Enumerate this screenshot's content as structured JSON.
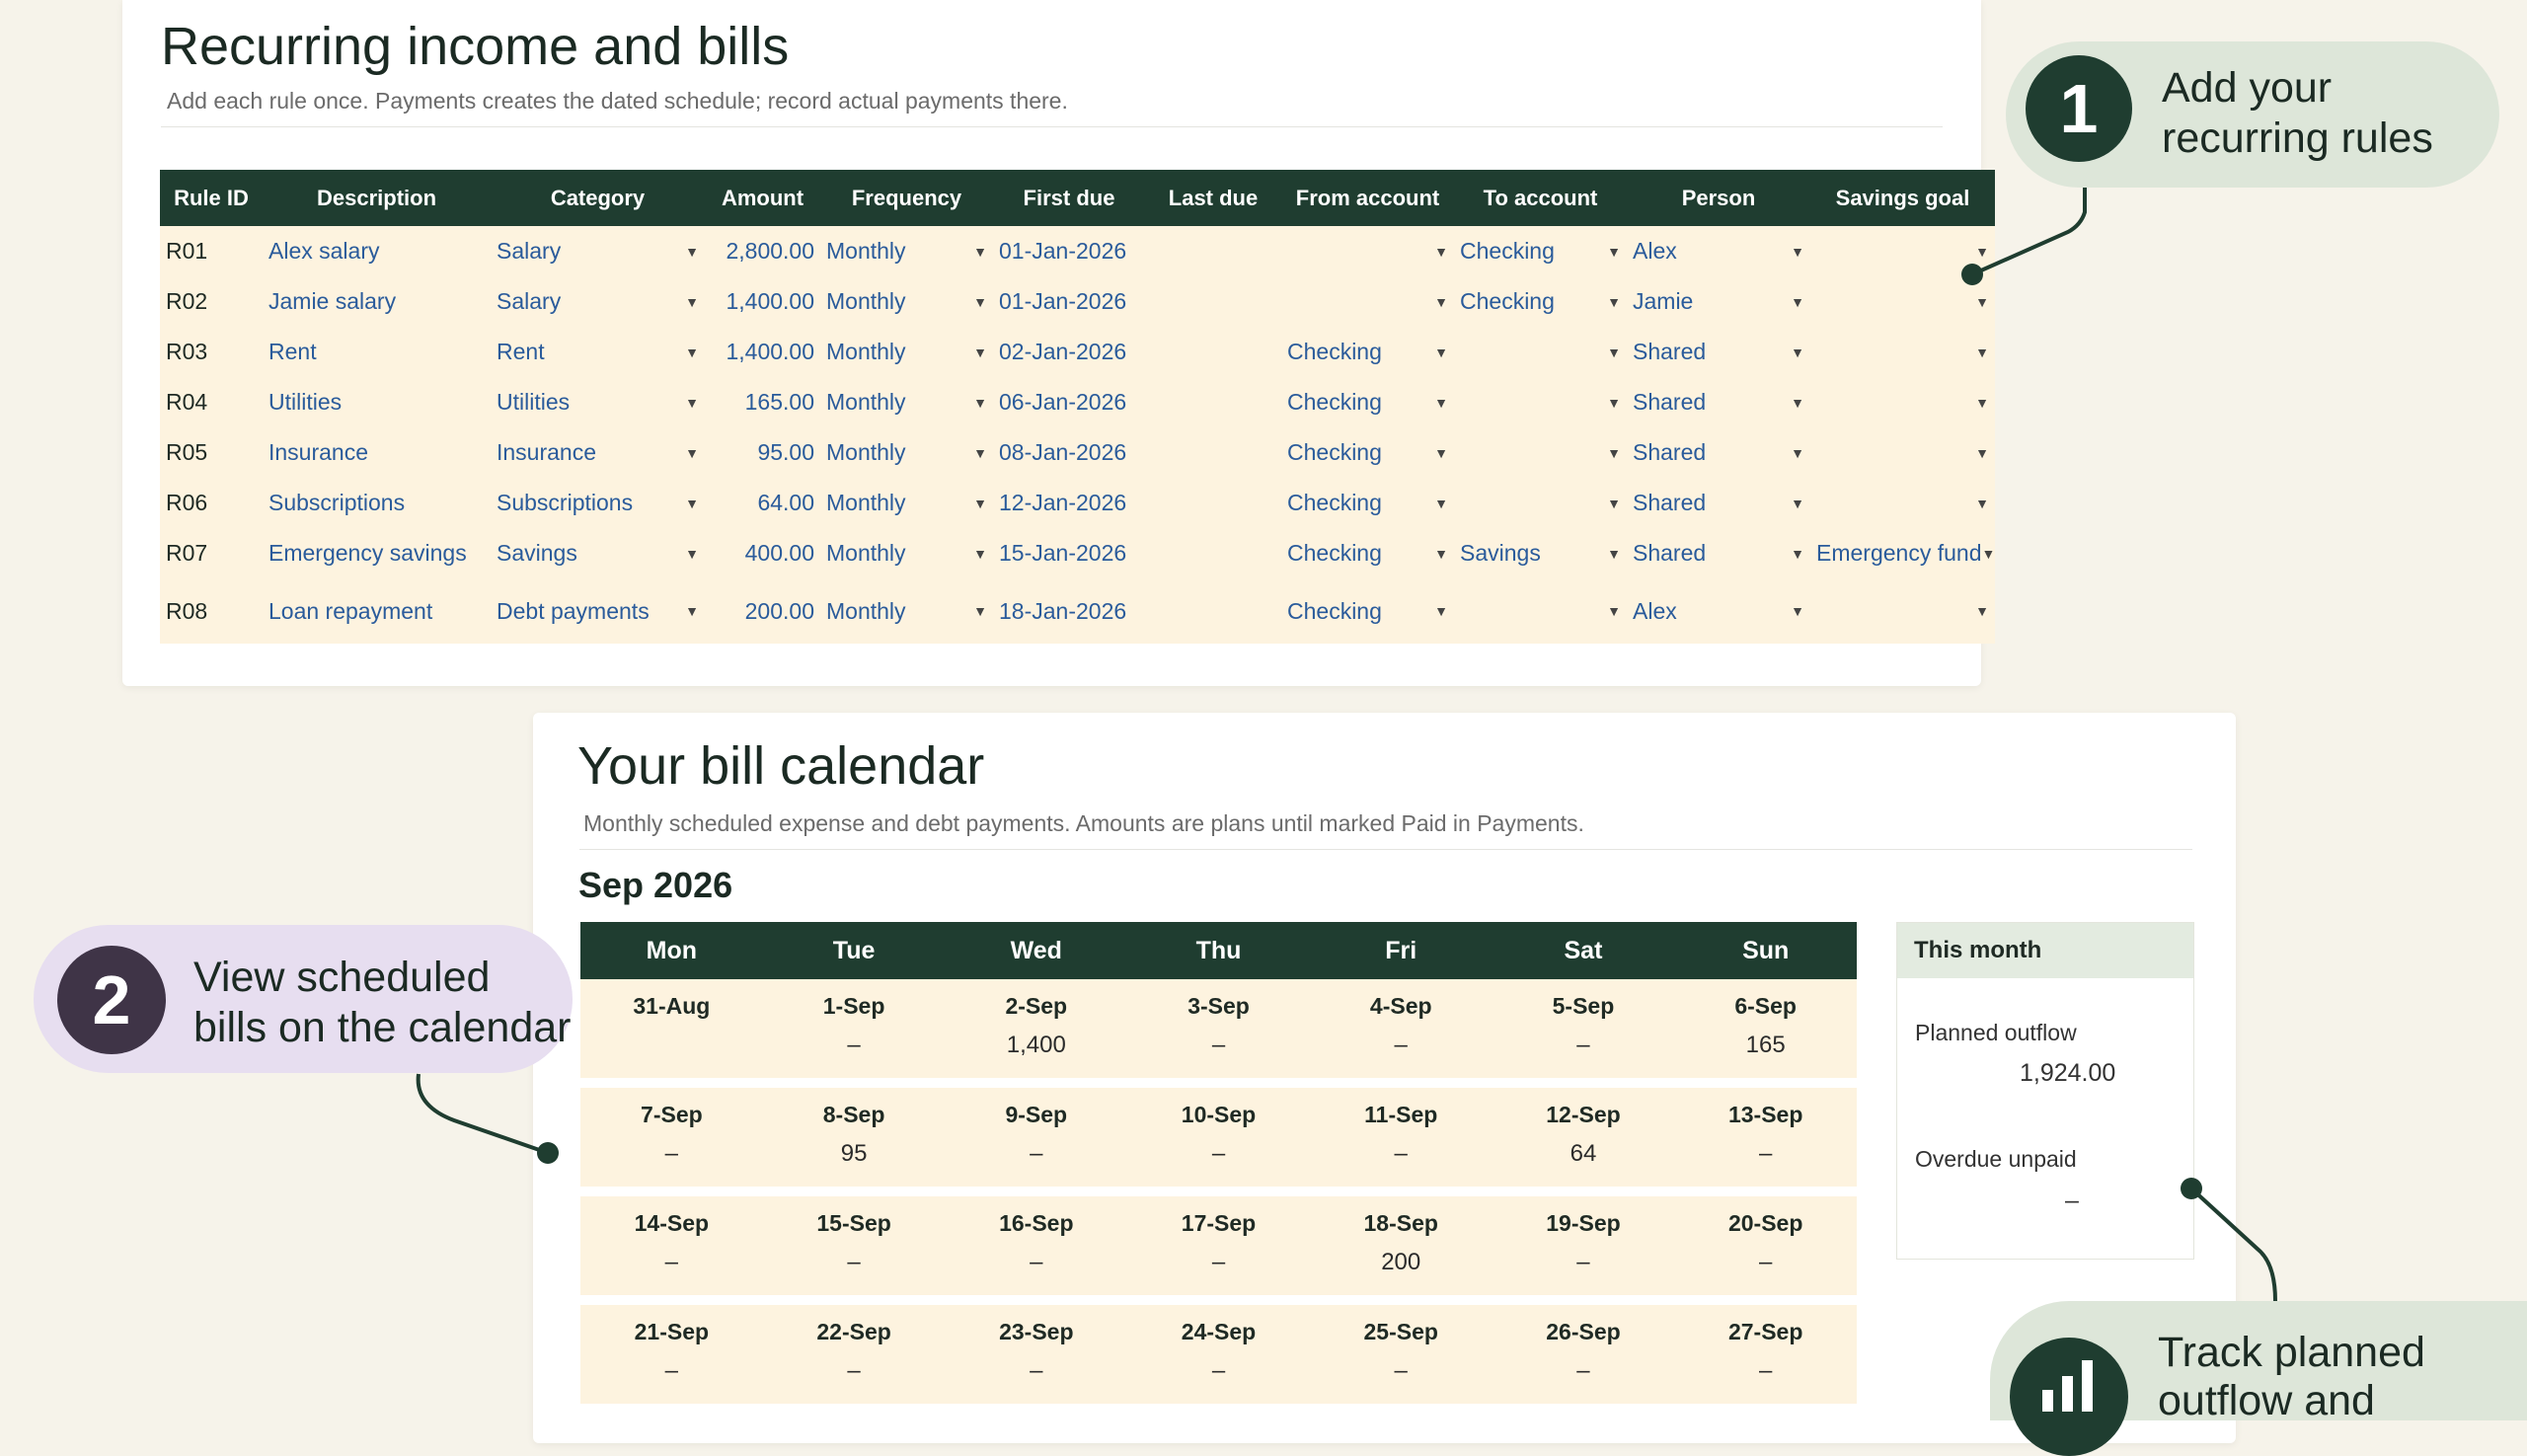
{
  "rules_panel": {
    "title": "Recurring income and bills",
    "subtitle": "Add each rule once. Payments creates the dated schedule; record actual payments there.",
    "columns": [
      "Rule ID",
      "Description",
      "Category",
      "Amount",
      "Frequency",
      "First due",
      "Last due",
      "From account",
      "To account",
      "Person",
      "Savings goal"
    ],
    "rows": [
      {
        "id": "R01",
        "description": "Alex salary",
        "category": "Salary",
        "amount": "2,800.00",
        "frequency": "Monthly",
        "first_due": "01-Jan-2026",
        "last_due": "",
        "from_account": "",
        "to_account": "Checking",
        "person": "Alex",
        "savings_goal": ""
      },
      {
        "id": "R02",
        "description": "Jamie salary",
        "category": "Salary",
        "amount": "1,400.00",
        "frequency": "Monthly",
        "first_due": "01-Jan-2026",
        "last_due": "",
        "from_account": "",
        "to_account": "Checking",
        "person": "Jamie",
        "savings_goal": ""
      },
      {
        "id": "R03",
        "description": "Rent",
        "category": "Rent",
        "amount": "1,400.00",
        "frequency": "Monthly",
        "first_due": "02-Jan-2026",
        "last_due": "",
        "from_account": "Checking",
        "to_account": "",
        "person": "Shared",
        "savings_goal": ""
      },
      {
        "id": "R04",
        "description": "Utilities",
        "category": "Utilities",
        "amount": "165.00",
        "frequency": "Monthly",
        "first_due": "06-Jan-2026",
        "last_due": "",
        "from_account": "Checking",
        "to_account": "",
        "person": "Shared",
        "savings_goal": ""
      },
      {
        "id": "R05",
        "description": "Insurance",
        "category": "Insurance",
        "amount": "95.00",
        "frequency": "Monthly",
        "first_due": "08-Jan-2026",
        "last_due": "",
        "from_account": "Checking",
        "to_account": "",
        "person": "Shared",
        "savings_goal": ""
      },
      {
        "id": "R06",
        "description": "Subscriptions",
        "category": "Subscriptions",
        "amount": "64.00",
        "frequency": "Monthly",
        "first_due": "12-Jan-2026",
        "last_due": "",
        "from_account": "Checking",
        "to_account": "",
        "person": "Shared",
        "savings_goal": ""
      },
      {
        "id": "R07",
        "description": "Emergency savings",
        "category": "Savings",
        "amount": "400.00",
        "frequency": "Monthly",
        "first_due": "15-Jan-2026",
        "last_due": "",
        "from_account": "Checking",
        "to_account": "Savings",
        "person": "Shared",
        "savings_goal": "Emergency fund"
      },
      {
        "id": "R08",
        "description": "Loan repayment",
        "category": "Debt payments",
        "amount": "200.00",
        "frequency": "Monthly",
        "first_due": "18-Jan-2026",
        "last_due": "",
        "from_account": "Checking",
        "to_account": "",
        "person": "Alex",
        "savings_goal": ""
      }
    ]
  },
  "calendar_panel": {
    "title": "Your bill calendar",
    "subtitle": "Monthly scheduled expense and debt payments. Amounts are plans until marked Paid in Payments.",
    "month": "Sep 2026",
    "weekdays": [
      "Mon",
      "Tue",
      "Wed",
      "Thu",
      "Fri",
      "Sat",
      "Sun"
    ],
    "weeks": [
      [
        {
          "date": "31-Aug",
          "value": ""
        },
        {
          "date": "1-Sep",
          "value": "–"
        },
        {
          "date": "2-Sep",
          "value": "1,400"
        },
        {
          "date": "3-Sep",
          "value": "–"
        },
        {
          "date": "4-Sep",
          "value": "–"
        },
        {
          "date": "5-Sep",
          "value": "–"
        },
        {
          "date": "6-Sep",
          "value": "165"
        }
      ],
      [
        {
          "date": "7-Sep",
          "value": "–"
        },
        {
          "date": "8-Sep",
          "value": "95"
        },
        {
          "date": "9-Sep",
          "value": "–"
        },
        {
          "date": "10-Sep",
          "value": "–"
        },
        {
          "date": "11-Sep",
          "value": "–"
        },
        {
          "date": "12-Sep",
          "value": "64"
        },
        {
          "date": "13-Sep",
          "value": "–"
        }
      ],
      [
        {
          "date": "14-Sep",
          "value": "–"
        },
        {
          "date": "15-Sep",
          "value": "–"
        },
        {
          "date": "16-Sep",
          "value": "–"
        },
        {
          "date": "17-Sep",
          "value": "–"
        },
        {
          "date": "18-Sep",
          "value": "200"
        },
        {
          "date": "19-Sep",
          "value": "–"
        },
        {
          "date": "20-Sep",
          "value": "–"
        }
      ],
      [
        {
          "date": "21-Sep",
          "value": "–"
        },
        {
          "date": "22-Sep",
          "value": "–"
        },
        {
          "date": "23-Sep",
          "value": "–"
        },
        {
          "date": "24-Sep",
          "value": "–"
        },
        {
          "date": "25-Sep",
          "value": "–"
        },
        {
          "date": "26-Sep",
          "value": "–"
        },
        {
          "date": "27-Sep",
          "value": "–"
        }
      ]
    ],
    "summary": {
      "header": "This month",
      "planned_label": "Planned outflow",
      "planned_value": "1,924.00",
      "overdue_label": "Overdue unpaid",
      "overdue_value": "–"
    }
  },
  "callouts": [
    {
      "number": "1",
      "text_line1": "Add your",
      "text_line2": "recurring rules",
      "color": "#dde6d9",
      "circle_color": "#1f3d30"
    },
    {
      "number": "2",
      "text_line1": "View scheduled",
      "text_line2": "bills on the calendar",
      "color": "#e7def0",
      "circle_color": "#3f3447"
    },
    {
      "text_line1": "Track planned",
      "text_line2": "outflow and",
      "color": "#dde6d9",
      "circle_color": "#1f3d30",
      "icon": "bar-chart-icon"
    }
  ],
  "colors": {
    "header_dark": "#1f3d30",
    "cell_fill": "#fdf3df",
    "link_blue": "#2a5b9b",
    "background": "#f6f3ea"
  }
}
